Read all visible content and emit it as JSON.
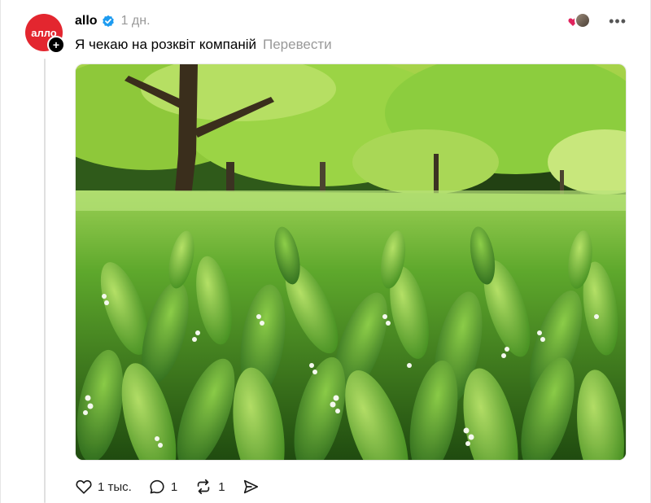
{
  "post": {
    "author": {
      "username": "allo",
      "avatar_text": "алло",
      "verified": true
    },
    "time_ago": "1 дн.",
    "text": "Я чекаю на розквіт компаній",
    "translate_label": "Перевести",
    "image": {
      "subject": "lily-of-the-valley-meadow-photo"
    },
    "stats": {
      "likes": "1 тыс.",
      "replies": "1",
      "reposts": "1"
    }
  },
  "icons": {
    "verified": "verified-badge-icon",
    "more": "more-options-icon",
    "like": "heart-icon",
    "reply": "comment-icon",
    "repost": "repost-icon",
    "share": "send-icon",
    "follow": "plus-icon"
  },
  "colors": {
    "brand": "#e3262f",
    "verified": "#1d9bf0",
    "muted_text": "#999999",
    "liked_heart": "#e0245e"
  }
}
